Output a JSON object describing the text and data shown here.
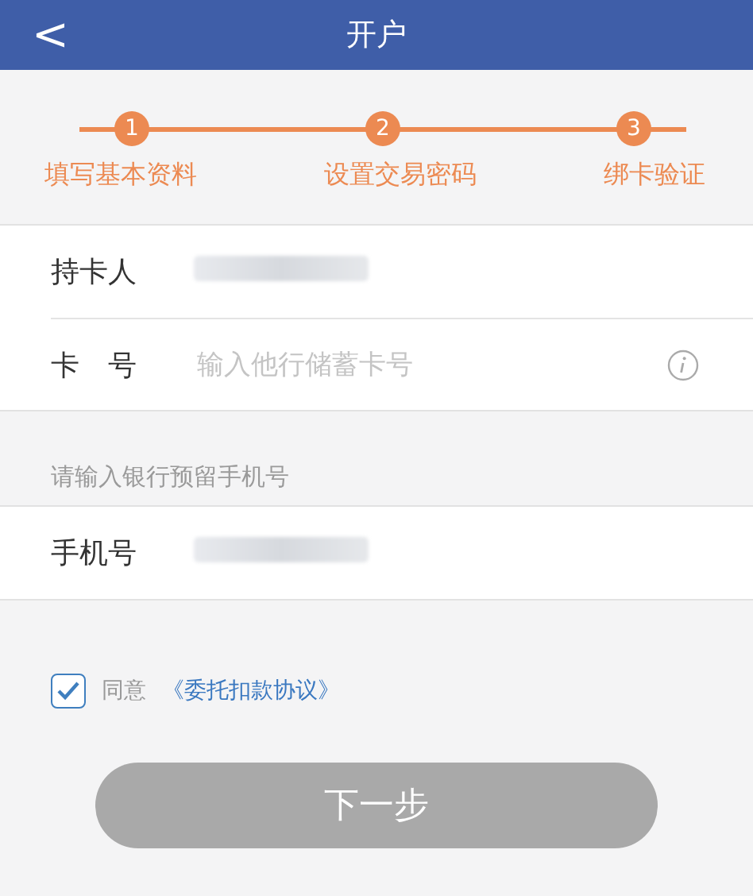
{
  "header": {
    "back": "<",
    "title": "开户"
  },
  "steps": [
    {
      "number": "1",
      "label": "填写基本资料"
    },
    {
      "number": "2",
      "label": "设置交易密码"
    },
    {
      "number": "3",
      "label": "绑卡验证"
    }
  ],
  "card_fields": [
    {
      "label": "持卡人",
      "kind": "redacted"
    },
    {
      "label": "卡　号",
      "kind": "input",
      "placeholder": "输入他行储蓄卡号"
    }
  ],
  "phone_hint": "请输入银行预留手机号",
  "phone_field": {
    "label": "手机号",
    "kind": "redacted"
  },
  "agreement": {
    "checked": true,
    "text": "同意",
    "link": "《委托扣款协议》"
  },
  "next_button": {
    "label": "下一步",
    "disabled": true
  }
}
